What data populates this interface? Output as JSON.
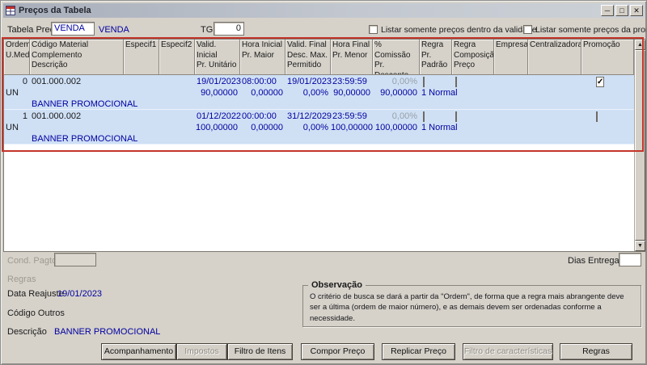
{
  "window": {
    "title": "Preços da Tabela"
  },
  "topbar": {
    "tabela_preco_label": "Tabela Preço",
    "tabela_preco_value": "VENDA",
    "tabela_preco_desc": "VENDA",
    "tg_label": "TG",
    "tg_value": "0",
    "check_validade": "Listar somente preços dentro da validade",
    "check_promocao": "Listar somente preços da promoção"
  },
  "grid": {
    "headers": [
      "Ordem\nU.Med.",
      "Código Material\nComplemento\nDescrição",
      "Especif1",
      "Especif2",
      "Valid. Inicial\nPr. Unitário",
      "Hora Inicial\nPr. Maior",
      "Valid. Final\nDesc. Max.\nPermitido",
      "Hora Final\nPr. Menor",
      "% Comissão\nPr. Desconto",
      "Regra\nPr. Padrão",
      "Regra\nComposição\nPreço",
      "Empresa",
      "Centralizadora",
      "Promoção"
    ],
    "rows": [
      {
        "ordem": "0",
        "codigo": "001.000.002",
        "umed": "UN",
        "descricao": "BANNER PROMOCIONAL",
        "valid_inicial": "19/01/2023",
        "hora_inicial": "08:00:00",
        "valid_final": "19/01/2023",
        "hora_final": "23:59:59",
        "comissao": "0,00%",
        "pr_unitario": "90,00000",
        "pr_maior": "0,00000",
        "desc_max": "0,00%",
        "pr_menor": "90,00000",
        "pr_desconto": "90,00000",
        "regra": "1 Normal",
        "regra_padrao_mark": "",
        "regra_composicao_mark": "",
        "promocao_mark": "✓"
      },
      {
        "ordem": "1",
        "codigo": "001.000.002",
        "umed": "UN",
        "descricao": "BANNER PROMOCIONAL",
        "valid_inicial": "01/12/2022",
        "hora_inicial": "00:00:00",
        "valid_final": "31/12/2029",
        "hora_final": "23:59:59",
        "comissao": "0,00%",
        "pr_unitario": "100,00000",
        "pr_maior": "0,00000",
        "desc_max": "0,00%",
        "pr_menor": "100,00000",
        "pr_desconto": "100,00000",
        "regra": "1 Normal",
        "regra_padrao_mark": "",
        "regra_composicao_mark": "",
        "promocao_mark": ""
      }
    ]
  },
  "details": {
    "cond_pagto_label": "Cond. Pagto.",
    "dias_entrega_label": "Dias Entrega",
    "regras_label": "Regras",
    "data_reajuste_label": "Data Reajuste",
    "data_reajuste_value": "19/01/2023",
    "codigo_outros_label": "Código Outros",
    "descricao_label": "Descrição",
    "descricao_value": "BANNER PROMOCIONAL"
  },
  "observacao": {
    "title": "Observação",
    "text": "O critério de busca se dará a partir da \"Ordem\", de forma que a regra mais abrangente deve ser a última (ordem de maior número), e as demais devem ser ordenadas conforme a necessidade."
  },
  "buttons": {
    "acompanhamento": "Acompanhamento",
    "impostos": "Impostos",
    "filtro_itens": "Filtro de Itens",
    "compor_preco": "Compor Preço",
    "replicar_preco": "Replicar Preço",
    "filtro_caract": "Filtro de características",
    "regras": "Regras"
  },
  "colors": {
    "row_highlight": "#cfe0f5",
    "value_navy": "#0000a0",
    "annotation_red": "#c4352a",
    "chrome_grey": "#d6d2ca"
  }
}
